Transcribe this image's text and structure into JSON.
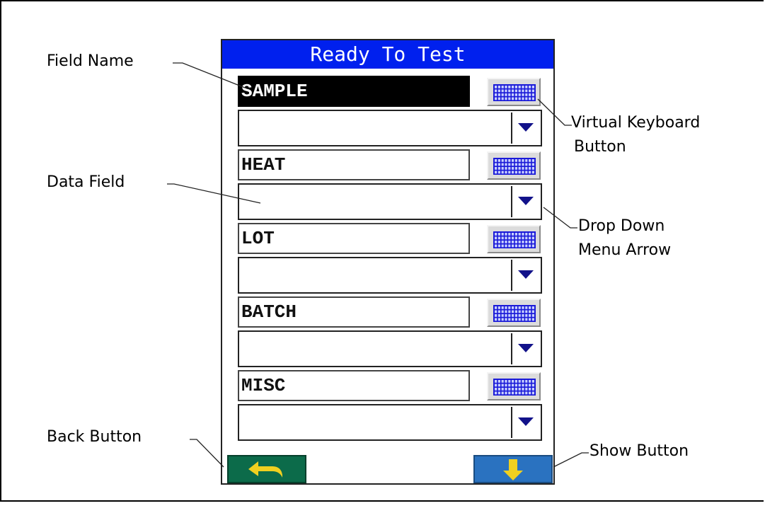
{
  "screen": {
    "title": "Ready To Test",
    "fields": [
      {
        "name": "SAMPLE",
        "selected": true,
        "value": ""
      },
      {
        "name": "HEAT",
        "selected": false,
        "value": ""
      },
      {
        "name": "LOT",
        "selected": false,
        "value": ""
      },
      {
        "name": "BATCH",
        "selected": false,
        "value": ""
      },
      {
        "name": "MISC",
        "selected": false,
        "value": ""
      }
    ],
    "back_button_icon": "back-arrow-icon",
    "show_button_icon": "down-arrow-icon"
  },
  "callouts": {
    "field_name": "Field Name",
    "data_field": "Data Field",
    "back_button": "Back Button",
    "virtual_keyboard_line1": "Virtual Keyboard",
    "virtual_keyboard_line2": "Button",
    "drop_down_line1": "Drop Down",
    "drop_down_line2": "Menu Arrow",
    "show_button": "Show Button"
  },
  "colors": {
    "title_bar": "#0020ee",
    "keyboard_icon": "#1a1ad8",
    "dropdown_arrow": "#12128a",
    "back_button": "#0c6b4a",
    "show_button": "#2a72c0",
    "nav_arrow": "#f0d020"
  }
}
